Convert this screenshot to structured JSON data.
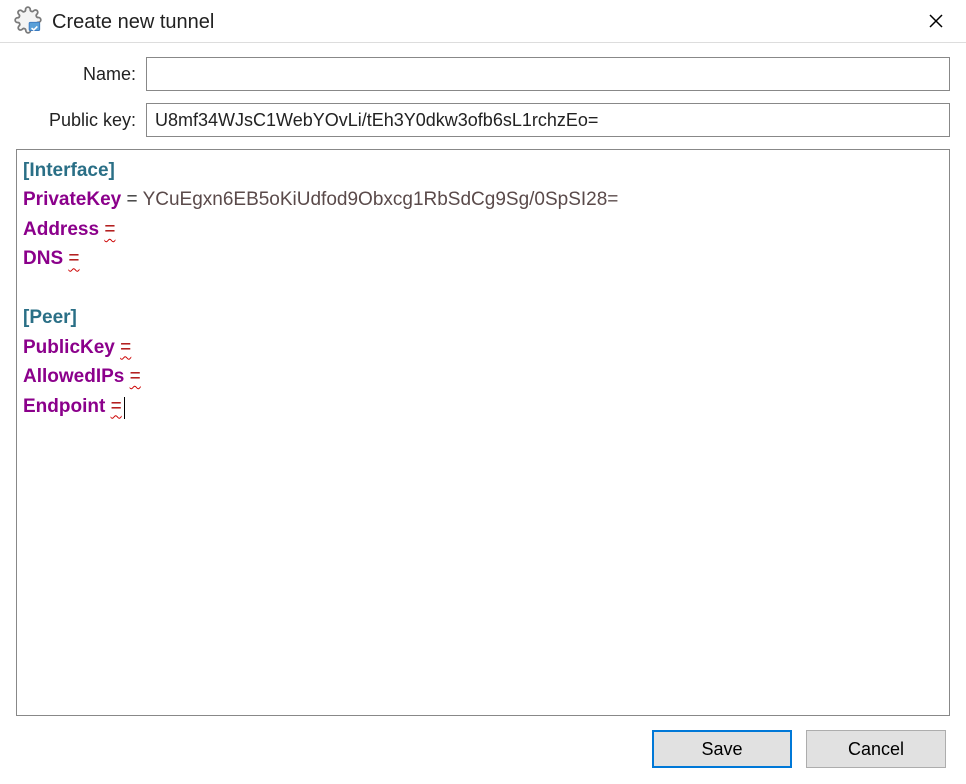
{
  "title": "Create new tunnel",
  "labels": {
    "name": "Name:",
    "publicKey": "Public key:"
  },
  "fields": {
    "name": "",
    "publicKey": "U8mf34WJsC1WebYOvLi/tEh3Y0dkw3ofb6sL1rchzEo="
  },
  "config": {
    "sectionInterface": "[Interface]",
    "privateKeyLabel": "PrivateKey",
    "privateKeyValue": "YCuEgxn6EB5oKiUdfod9Obxcg1RbSdCg9Sg/0SpSI28=",
    "addressLabel": "Address",
    "dnsLabel": "DNS",
    "sectionPeer": "[Peer]",
    "peerPublicKeyLabel": "PublicKey",
    "allowedIPsLabel": "AllowedIPs",
    "endpointLabel": "Endpoint",
    "eq": "=",
    "sp": " "
  },
  "buttons": {
    "save": "Save",
    "cancel": "Cancel"
  }
}
